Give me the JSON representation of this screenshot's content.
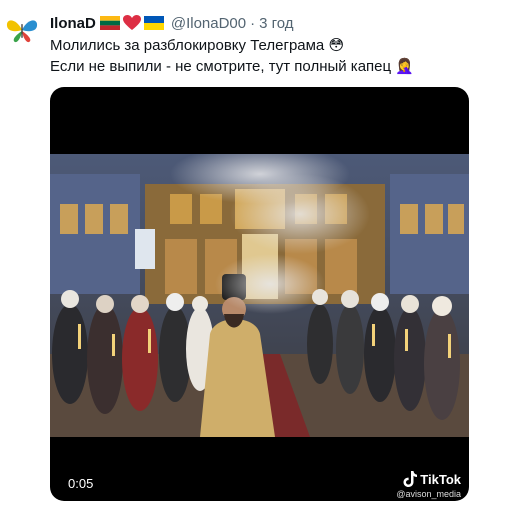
{
  "tweet": {
    "author_name": "IlonaD",
    "handle": "@IlonaD00",
    "separator": "·",
    "time": "3 год",
    "lines": [
      "Молились за разблокировку Телеграма 😳",
      "Если не выпили - не смотрите, тут полный капец 🤦‍♀️"
    ]
  },
  "video": {
    "timestamp": "0:05",
    "watermark_brand": "TikTok",
    "watermark_user": "@avison_media"
  },
  "icons": {
    "avatar": "butterfly-avatar-icon",
    "flags": [
      "lithuania-flag-icon",
      "red-heart-icon",
      "ukraine-flag-icon"
    ],
    "watermark": "tiktok-note-icon"
  },
  "colors": {
    "secondary_text": "#536471",
    "primary_text": "#0f1419",
    "video_background": "#000000"
  }
}
